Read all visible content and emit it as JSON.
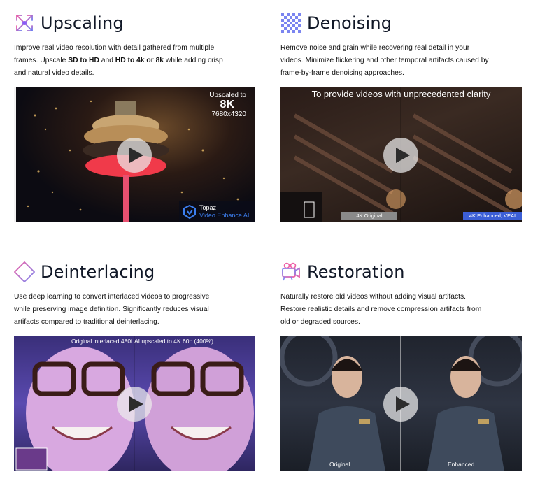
{
  "cards": [
    {
      "title": "Upscaling",
      "desc": {
        "pre": "Improve real video resolution with detail gathered from multiple frames. Upscale ",
        "b1": "SD to HD",
        "mid1": " and ",
        "b2": "HD to 4k or 8k",
        "post": " while adding crisp and natural video details."
      },
      "overlay": {
        "line1": "Upscaled to",
        "line2": "8K",
        "line3": "7680x4320",
        "brand": "Topaz",
        "product": "Video Enhance AI"
      },
      "icon": "expand-arrows-icon"
    },
    {
      "title": "Denoising",
      "desc": "Remove noise and grain while recovering real detail in your videos. Minimize flickering and other temporal artifacts caused by frame-by-frame denoising approaches.",
      "overlay": {
        "caption": "To provide videos with unprecedented clarity",
        "left_tag": "4K Original",
        "right_tag": "4K Enhanced, VEAI"
      },
      "icon": "checker-grid-icon"
    },
    {
      "title": "Deinterlacing",
      "desc": "Use deep learning to convert interlaced videos to progressive while preserving image definition. Significantly reduces visual artifacts compared to traditional deinterlacing.",
      "overlay": {
        "left_caption": "Original interlaced 480i",
        "right_caption": "AI upscaled to 4K 60p (400%)"
      },
      "icon": "striped-diamond-icon"
    },
    {
      "title": "Restoration",
      "desc": "Naturally restore old videos without adding visual artifacts. Restore realistic details and remove compression artifacts from old or degraded sources.",
      "overlay": {
        "left_tag": "Original",
        "right_tag": "Enhanced"
      },
      "icon": "camera-gear-icon"
    }
  ],
  "colors": {
    "accent_blue": "#3c5fd6",
    "accent_purple": "#8a5cf6",
    "accent_pink": "#ee5fa6"
  }
}
